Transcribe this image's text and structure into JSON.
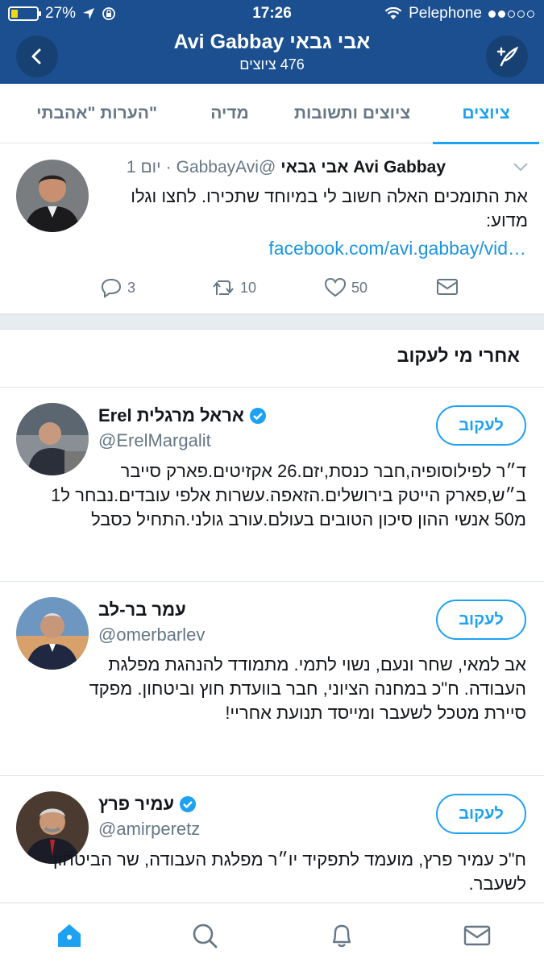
{
  "status": {
    "battery": "27%",
    "battery_level": 0.27,
    "time": "17:26",
    "carrier": "Pelephone"
  },
  "header": {
    "title": "Avi Gabbay אבי גבאי",
    "subtitle": "476 ציוצים"
  },
  "tabs": [
    {
      "label": "ציוצים",
      "active": true
    },
    {
      "label": "ציוצים ותשובות",
      "active": false
    },
    {
      "label": "מדיה",
      "active": false
    },
    {
      "label": "הערות \"אהבתי\"",
      "active": false
    }
  ],
  "tweet": {
    "name": "Avi Gabbay אבי גבאי",
    "handle": "@GabbayAvi",
    "dot": "·",
    "time": "יום 1",
    "text": "את התומכים האלה חשוב לי במיוחד שתכירו. לחצו וגלו מדוע:",
    "link": "facebook.com/avi.gabbay/vid…",
    "replies": "3",
    "retweets": "10",
    "likes": "50"
  },
  "who_to_follow": {
    "title": "אחרי מי לעקוב",
    "follow_label": "לעקוב",
    "users": [
      {
        "name": "Erel אראל מרגלית",
        "verified": true,
        "handle": "@ErelMargalit",
        "bio": "ד״ר לפילוסופיה,חבר כנסת,יזם.26 אקזיטים.פארק סייבר ב״ש,פארק הייטק בירושלים.הזאפה.עשרות אלפי עובדים.נבחר ל1 מ50 אנשי ההון סיכון הטובים בעולם.עורב גולני.התחיל כסבל"
      },
      {
        "name": "עמר בר-לב",
        "verified": false,
        "handle": "@omerbarlev",
        "bio": "אב למאי, שחר ונעם, נשוי לתמי. מתמודד להנהגת מפלגת העבודה. ח\"כ במחנה הציוני, חבר בוועדת חוץ וביטחון. מפקד סיירת מטכל לשעבר ומייסד תנועת אחריי!"
      },
      {
        "name": "עמיר פרץ",
        "verified": true,
        "handle": "@amirperetz",
        "bio": "ח\"כ עמיר פרץ, מועמד לתפקיד יו״ר מפלגת העבודה, שר הביטחון לשעבר."
      }
    ]
  },
  "colors": {
    "brand": "#1b4f8f",
    "accent": "#1da1f2",
    "muted": "#657786"
  },
  "icons": {
    "back": "chevron-left-icon",
    "compose": "compose-feather-icon",
    "caret": "chevron-down-icon",
    "reply": "reply-icon",
    "retweet": "retweet-icon",
    "like": "heart-icon",
    "dm": "envelope-icon",
    "verified": "verified-badge-icon",
    "home": "home-icon",
    "search": "search-icon",
    "notifications": "bell-icon",
    "messages": "envelope-icon"
  }
}
